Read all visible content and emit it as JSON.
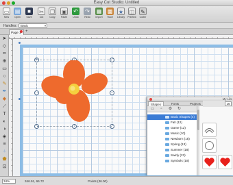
{
  "window": {
    "title": "Easy Cut Studio: Untitled"
  },
  "toolbar": {
    "buttons": [
      {
        "label": "New",
        "icon": "new-file-icon"
      },
      {
        "label": "Open",
        "icon": "open-folder-icon"
      },
      {
        "label": "Save",
        "icon": "save-icon"
      },
      {
        "label": "Cut",
        "icon": "cut-icon"
      },
      {
        "label": "Copy",
        "icon": "copy-icon"
      },
      {
        "label": "Paste",
        "icon": "paste-icon"
      },
      {
        "label": "Undo",
        "icon": "undo-icon"
      },
      {
        "label": "Redo",
        "icon": "redo-icon"
      },
      {
        "label": "Import",
        "icon": "import-icon"
      },
      {
        "label": "Trace",
        "icon": "trace-icon"
      },
      {
        "label": "Library",
        "icon": "library-icon"
      },
      {
        "label": "Preview",
        "icon": "preview-icon"
      },
      {
        "label": "Cutter",
        "icon": "cutter-icon"
      }
    ]
  },
  "handles": {
    "label": "Handles:",
    "value": "Basic"
  },
  "tabs": {
    "page": "Page 1"
  },
  "panel": {
    "library_title": "My Libr",
    "tabs": [
      "Shapes",
      "Fonts",
      "Projects"
    ],
    "categories": [
      {
        "name": "Basic Shapes (4)",
        "selected": true
      },
      {
        "name": "Fall (12)",
        "selected": false
      },
      {
        "name": "Game (12)",
        "selected": false
      },
      {
        "name": "Music (10)",
        "selected": false
      },
      {
        "name": "Newborn (15)",
        "selected": false
      },
      {
        "name": "Spring (13)",
        "selected": false
      },
      {
        "name": "Summer (18)",
        "selected": false
      },
      {
        "name": "Swirly (23)",
        "selected": false
      },
      {
        "name": "Symbols (18)",
        "selected": false
      }
    ],
    "size_value": "16"
  },
  "status": {
    "zoom": "34%",
    "coords": "346.91, 66.72",
    "points": "Points (36.00)"
  },
  "colors": {
    "flower_petal": "#ee6a2d",
    "flower_center": "#f4d03f",
    "mat": "#8cbde6",
    "heart": "#e8201b",
    "selection": "#3a7bd5"
  }
}
